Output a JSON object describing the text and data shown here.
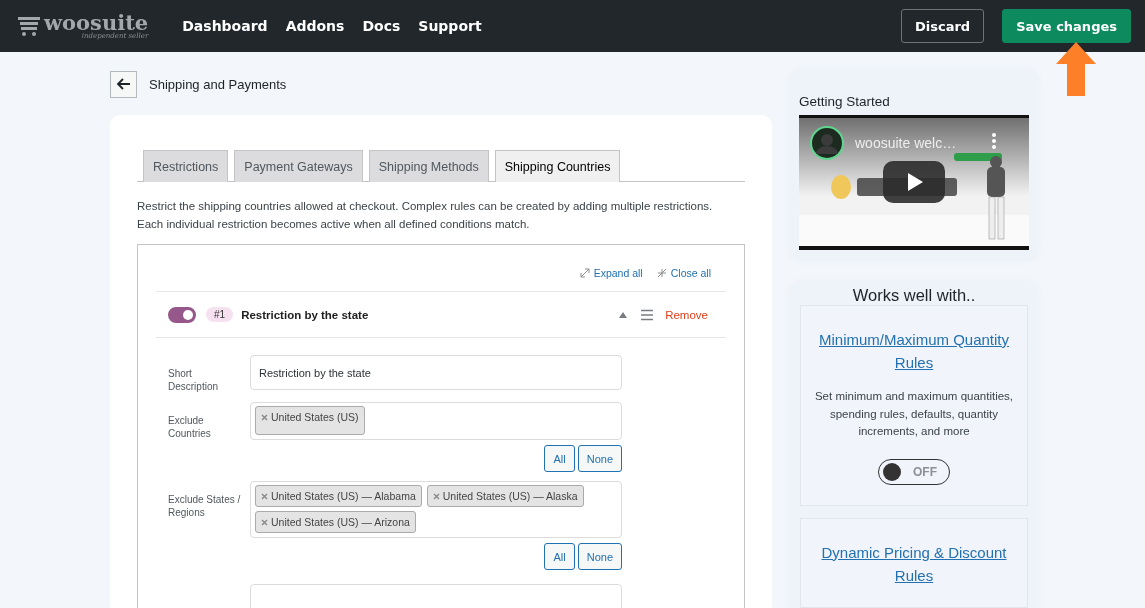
{
  "brand": {
    "name": "woosuite",
    "tagline": "independent seller"
  },
  "nav": [
    {
      "label": "Dashboard"
    },
    {
      "label": "Addons"
    },
    {
      "label": "Docs"
    },
    {
      "label": "Support"
    }
  ],
  "header_actions": [
    {
      "label": "Discard",
      "kind": "secondary"
    },
    {
      "label": "Save changes",
      "kind": "primary"
    }
  ],
  "page": {
    "title": "Shipping and Payments"
  },
  "tabs": [
    {
      "label": "Restrictions",
      "selected": false
    },
    {
      "label": "Payment Gateways",
      "selected": false
    },
    {
      "label": "Shipping Methods",
      "selected": false
    },
    {
      "label": "Shipping Countries",
      "selected": true
    }
  ],
  "description": "Restrict the shipping countries allowed at checkout. Complex rules can be created by adding multiple restrictions.\nEach individual restriction becomes active when all defined conditions match.",
  "toolbar": [
    {
      "label": "Expand all",
      "kind": "expand"
    },
    {
      "label": "Close all",
      "kind": "collapse"
    }
  ],
  "restriction": {
    "enabled": true,
    "number": "#1",
    "title": "Restriction by the state",
    "expanded": true,
    "remove": "Remove",
    "fields": [
      {
        "label": "Short Description",
        "kind": "text",
        "value": "Restriction by the state"
      },
      {
        "label": "Exclude Countries",
        "kind": "tags",
        "tags": [
          "United States (US)"
        ],
        "actions": [
          "All",
          "None"
        ]
      },
      {
        "label": "Exclude States / Regions",
        "kind": "tags",
        "tags": [
          "United States (US) — Alabama",
          "United States (US) — Alaska",
          "United States (US) — Arizona"
        ],
        "actions": [
          "All",
          "None"
        ]
      }
    ]
  },
  "sidebar": {
    "video_card": {
      "title": "Getting Started",
      "video_title": "woosuite welc…"
    },
    "works_with": {
      "title": "Works well with..",
      "items": [
        {
          "name": "Minimum/Maximum Quantity Rules",
          "description": "Set minimum and maximum quantities, spending rules, defaults, quantity increments, and more",
          "toggle": {
            "on": false,
            "label": "OFF"
          }
        },
        {
          "name": "Dynamic Pricing & Discount Rules"
        }
      ]
    }
  }
}
